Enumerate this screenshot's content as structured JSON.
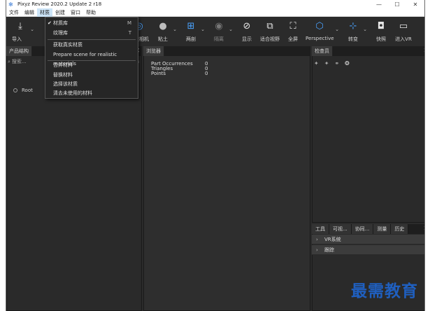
{
  "window": {
    "title": "Pixyz Review 2020.2 Update 2 r18",
    "minimize": "—",
    "maximize": "☐",
    "close": "✕"
  },
  "menubar": [
    "文件",
    "编辑",
    "材质",
    "创建",
    "窗口",
    "帮助"
  ],
  "toolbar": {
    "import": "导入",
    "camera": "人造相机",
    "clay": "粘土",
    "section": "两剖",
    "hide": "隔离",
    "show": "显示",
    "fit_view": "适合视野",
    "fullscreen": "全屏",
    "perspective": "Perspective",
    "transform": "转变",
    "snapshot": "快照",
    "vr": "进入VR"
  },
  "dropdown": {
    "items": [
      {
        "label": "材质库",
        "shortcut": "M",
        "checked": true
      },
      {
        "label": "纹理库",
        "shortcut": "T",
        "checked": false
      },
      {
        "label": "获取真实材质"
      },
      {
        "label": "Prepare scene for realistic materials"
      },
      {
        "label": "合并材料"
      },
      {
        "label": "替换材料"
      },
      {
        "label": "选择该材质"
      },
      {
        "label": "清去未使用的材料"
      }
    ]
  },
  "left_panel": {
    "tab": "产品结构",
    "search_placeholder": "搜索...",
    "search_suffix": "h",
    "root": "Root"
  },
  "viewer": {
    "tab": "浏览器",
    "stats": [
      {
        "label": "Part Occurrences",
        "value": "0"
      },
      {
        "label": "Triangles",
        "value": "0"
      },
      {
        "label": "Points",
        "value": "0"
      }
    ]
  },
  "inspector": {
    "tab": "检查员"
  },
  "bottom_tabs": [
    "工具",
    "可视...",
    "协同...",
    "测量",
    "历史"
  ],
  "tree": [
    "VR系统",
    "跟踪"
  ],
  "watermark": "最需教育",
  "colors": {
    "accent": "#3a7bd5",
    "watermark": "#1f5fbf",
    "bg": "#2b2b2b"
  }
}
